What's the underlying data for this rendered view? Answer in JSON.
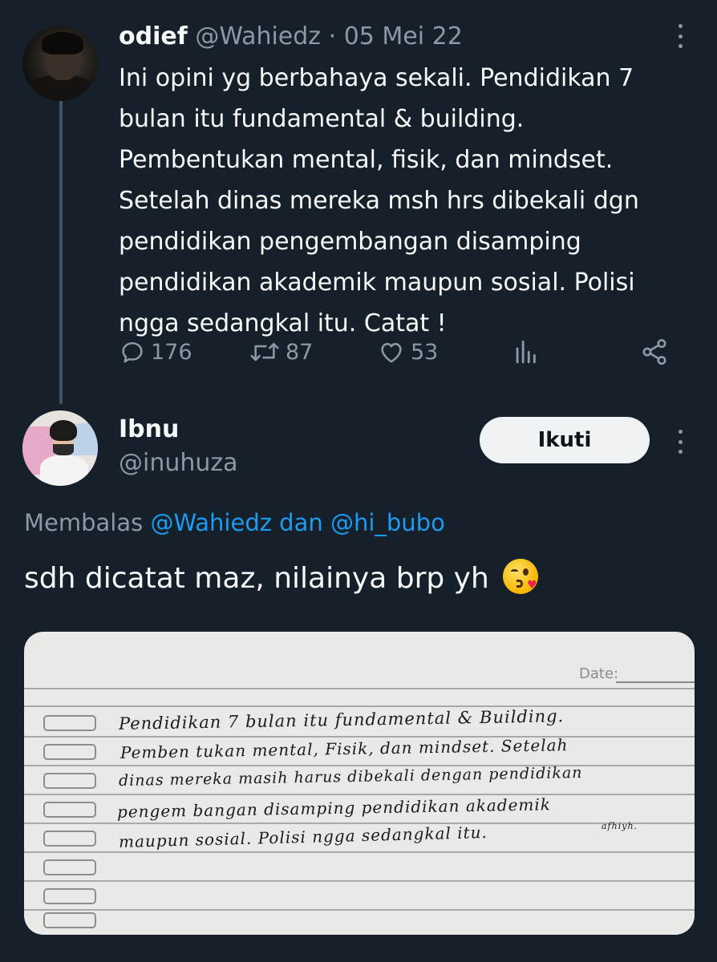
{
  "tweet": {
    "author_name": "odief",
    "handle": "@Wahiedz",
    "separator": "·",
    "date": "05 Mei 22",
    "text": "Ini opini yg berbahaya sekali. Pendidikan 7 bulan itu fundamental & building. Pembentukan mental, fisik, dan mindset. Setelah dinas mereka msh hrs dibekali dgn pendidikan pengembangan disamping pendidikan akademik maupun sosial. Polisi ngga sedangkal itu. Catat !",
    "actions": {
      "replies": "176",
      "retweets": "87",
      "likes": "53"
    }
  },
  "reply": {
    "author_name": "Ibnu",
    "handle": "@inuhuza",
    "follow_label": "Ikuti",
    "replying_prefix": "Membalas",
    "replying_to_1": "@Wahiedz",
    "replying_conjunction": "dan",
    "replying_to_2": "@hi_bubo",
    "text": "sdh dicatat maz, nilainya brp yh",
    "emoji": "kissing-face-with-heart"
  },
  "photo": {
    "date_label": "Date:",
    "lines": [
      "Pendidikan 7 bulan itu fundamental & Building.",
      "Pemben tukan mental, Fisik, dan mindset. Setelah",
      "dinas mereka masih harus dibekali dengan pendidikan",
      "pengem bangan disamping pendidikan akademik",
      "maupun sosial. Polisi ngga sedangkal itu."
    ],
    "signature": "afhiyh."
  },
  "colors": {
    "background": "#15202b",
    "text": "#f7f9f9",
    "muted": "#8b98a5",
    "link": "#1d9bf0",
    "thread_line": "#425364"
  }
}
